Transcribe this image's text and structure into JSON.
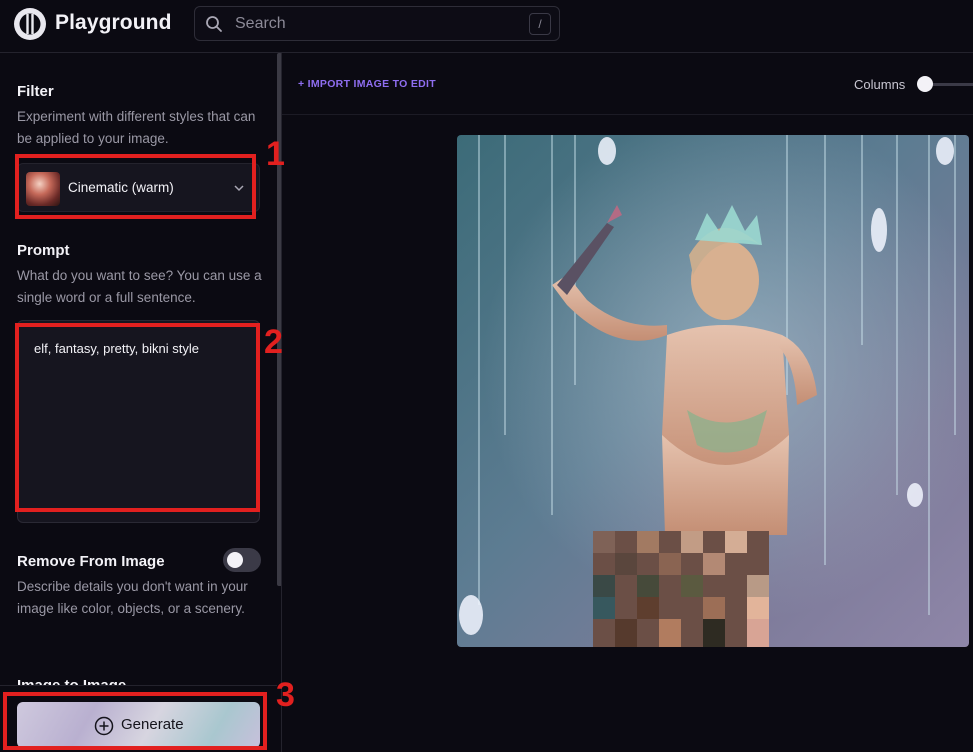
{
  "app": {
    "title": "Playground",
    "logo_icon": "playground-logo-icon"
  },
  "search": {
    "placeholder": "Search",
    "shortcut": "/",
    "icon": "search-icon"
  },
  "sidebar": {
    "filter": {
      "title": "Filter",
      "description": "Experiment with different styles that can be applied to your image.",
      "selected": "Cinematic (warm)"
    },
    "prompt": {
      "title": "Prompt",
      "description": "What do you want to see? You can use a single word or a full sentence.",
      "value": "elf, fantasy, pretty, bikni style"
    },
    "remove": {
      "title": "Remove From Image",
      "description": "Describe details you don't want in your image like color, objects, or a scenery.",
      "enabled": false
    },
    "image_to_image": {
      "title": "Image to Image"
    },
    "generate": {
      "label": "Generate",
      "icon": "plus-circle-icon"
    }
  },
  "main": {
    "import_label": "+ IMPORT IMAGE TO EDIT",
    "columns_label": "Columns",
    "columns_value": 0
  },
  "annotations": [
    "1",
    "2",
    "3"
  ],
  "colors": {
    "accent": "#8f6ef0",
    "annotation": "#e2201f",
    "background": "#0b0a12"
  }
}
